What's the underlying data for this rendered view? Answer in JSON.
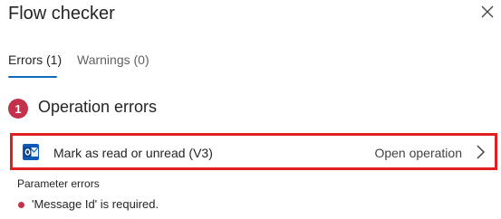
{
  "panel": {
    "title": "Flow checker"
  },
  "tabs": [
    {
      "label": "Errors (1)",
      "active": true
    },
    {
      "label": "Warnings (0)",
      "active": false
    }
  ],
  "section": {
    "count": "1",
    "title": "Operation errors"
  },
  "operation": {
    "icon": "outlook-icon",
    "label": "Mark as read or unread (V3)",
    "open_label": "Open operation"
  },
  "parameters": {
    "heading": "Parameter errors",
    "errors": [
      "'Message Id' is required."
    ]
  },
  "colors": {
    "accent": "#0f6cbd",
    "error": "#c4314b",
    "highlight": "#e02020",
    "outlook_blue": "#0f5ab8"
  }
}
